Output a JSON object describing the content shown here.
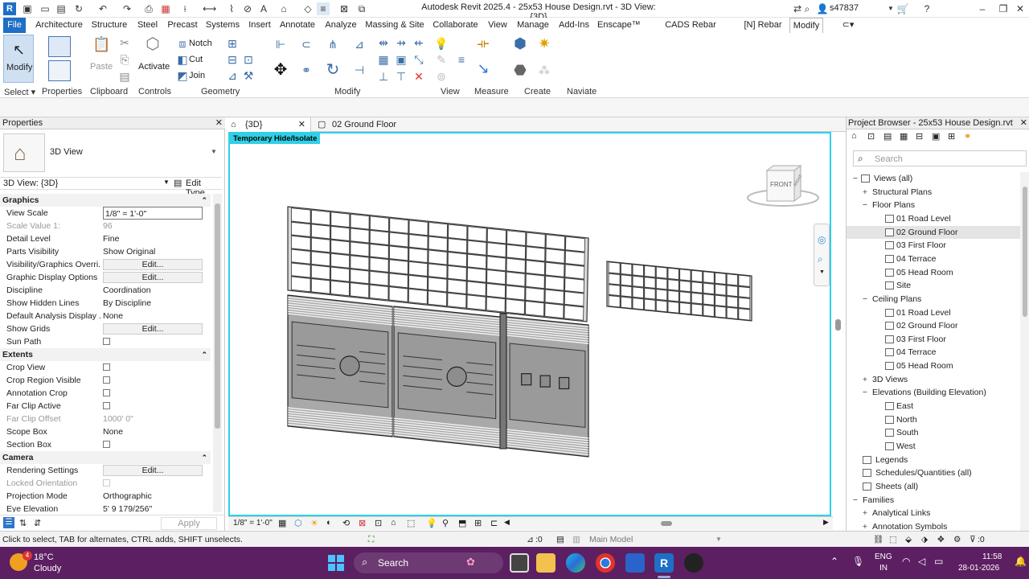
{
  "window": {
    "title": "Autodesk Revit 2025.4 - 25x53 House Design.rvt - 3D View: {3D}",
    "user": "s47837"
  },
  "menu": {
    "tabs": [
      "File",
      "Architecture",
      "Structure",
      "Steel",
      "Precast",
      "Systems",
      "Insert",
      "Annotate",
      "Analyze",
      "Massing & Site",
      "Collaborate",
      "View",
      "Manage",
      "Add-Ins",
      "Enscape™",
      "CADS Rebar Extensions",
      "[N] Rebar",
      "Modify"
    ],
    "active": "Modify"
  },
  "ribbon": {
    "modify": "Modify",
    "activate": "Activate",
    "notch": "Notch",
    "cut": "Cut",
    "join": "Join",
    "paste": "Paste",
    "panels": {
      "select": "Select",
      "properties": "Properties",
      "clipboard": "Clipboard",
      "controls": "Controls",
      "geometry": "Geometry",
      "modify": "Modify",
      "view": "View",
      "measure": "Measure",
      "create": "Create",
      "naviate": "Naviate"
    }
  },
  "properties": {
    "title": "Properties",
    "type_name": "3D View",
    "instance": "3D View: {3D}",
    "edit_type": "Edit Type",
    "apply": "Apply",
    "rows": [
      {
        "section": "Graphics"
      },
      {
        "k": "View Scale",
        "v": "1/8\" = 1'-0\"",
        "field": true
      },
      {
        "k": "Scale Value    1:",
        "v": "96",
        "dim": true
      },
      {
        "k": "Detail Level",
        "v": "Fine"
      },
      {
        "k": "Parts Visibility",
        "v": "Show Original"
      },
      {
        "k": "Visibility/Graphics Overri...",
        "v": "Edit...",
        "btn": true
      },
      {
        "k": "Graphic Display Options",
        "v": "Edit...",
        "btn": true
      },
      {
        "k": "Discipline",
        "v": "Coordination"
      },
      {
        "k": "Show Hidden Lines",
        "v": "By Discipline"
      },
      {
        "k": "Default Analysis Display ...",
        "v": "None"
      },
      {
        "k": "Show Grids",
        "v": "Edit...",
        "btn": true
      },
      {
        "k": "Sun Path",
        "cb": true
      },
      {
        "section": "Extents"
      },
      {
        "k": "Crop View",
        "cb": true
      },
      {
        "k": "Crop Region Visible",
        "cb": true
      },
      {
        "k": "Annotation Crop",
        "cb": true
      },
      {
        "k": "Far Clip Active",
        "cb": true
      },
      {
        "k": "Far Clip Offset",
        "v": "1000'  0\"",
        "dim": true
      },
      {
        "k": "Scope Box",
        "v": "None"
      },
      {
        "k": "Section Box",
        "cb": true
      },
      {
        "section": "Camera"
      },
      {
        "k": "Rendering Settings",
        "v": "Edit...",
        "btn": true
      },
      {
        "k": "Locked Orientation",
        "cb": true,
        "dim": true
      },
      {
        "k": "Projection Mode",
        "v": "Orthographic"
      },
      {
        "k": "Eye Elevation",
        "v": "5'  9 179/256\""
      }
    ]
  },
  "view_tabs": [
    {
      "label": "{3D}",
      "active": true
    },
    {
      "label": "02 Ground Floor",
      "active": false
    }
  ],
  "viewport": {
    "banner": "Temporary Hide/Isolate",
    "viewcube_front": "FRONT",
    "viewcube_right": "RIGHT",
    "scale": "1/8\" = 1'-0\""
  },
  "browser": {
    "title": "Project Browser - 25x53 House Design.rvt",
    "search_placeholder": "Search",
    "items": [
      {
        "label": "Views (all)",
        "level": 0,
        "sym": "−",
        "icon": true
      },
      {
        "label": "Structural Plans",
        "level": 1,
        "sym": "+"
      },
      {
        "label": "Floor Plans",
        "level": 1,
        "sym": "−"
      },
      {
        "label": "01 Road Level",
        "level": 2
      },
      {
        "label": "02 Ground Floor",
        "level": 2,
        "selected": true
      },
      {
        "label": "03 First Floor",
        "level": 2
      },
      {
        "label": "04 Terrace",
        "level": 2
      },
      {
        "label": "05 Head Room",
        "level": 2
      },
      {
        "label": "Site",
        "level": 2
      },
      {
        "label": "Ceiling Plans",
        "level": 1,
        "sym": "−"
      },
      {
        "label": "01 Road Level",
        "level": 2
      },
      {
        "label": "02 Ground Floor",
        "level": 2
      },
      {
        "label": "03 First Floor",
        "level": 2
      },
      {
        "label": "04 Terrace",
        "level": 2
      },
      {
        "label": "05 Head Room",
        "level": 2
      },
      {
        "label": "3D Views",
        "level": 1,
        "sym": "+"
      },
      {
        "label": "Elevations (Building Elevation)",
        "level": 1,
        "sym": "−"
      },
      {
        "label": "East",
        "level": 2
      },
      {
        "label": "North",
        "level": 2
      },
      {
        "label": "South",
        "level": 2
      },
      {
        "label": "West",
        "level": 2
      },
      {
        "label": "Legends",
        "level": 0,
        "icon": true
      },
      {
        "label": "Schedules/Quantities (all)",
        "level": 0,
        "icon": true
      },
      {
        "label": "Sheets (all)",
        "level": 0,
        "icon": true
      },
      {
        "label": "Families",
        "level": 0,
        "sym": "−"
      },
      {
        "label": "Analytical Links",
        "level": 1,
        "sym": "+"
      },
      {
        "label": "Annotation Symbols",
        "level": 1,
        "sym": "+"
      }
    ]
  },
  "status": {
    "hint": "Click to select, TAB for alternates, CTRL adds, SHIFT unselects.",
    "filter_count": ":0",
    "model": "Main Model",
    "select_count": ":0"
  },
  "taskbar": {
    "temp": "18°C",
    "weather": "Cloudy",
    "badge": "4",
    "search": "Search",
    "lang1": "ENG",
    "lang2": "IN",
    "time": "11:58",
    "date": "28-01-2026"
  },
  "colors": {
    "accent": "#2fd0e6",
    "file_tab": "#1e6fc5",
    "taskbar": "#5c1f62"
  }
}
